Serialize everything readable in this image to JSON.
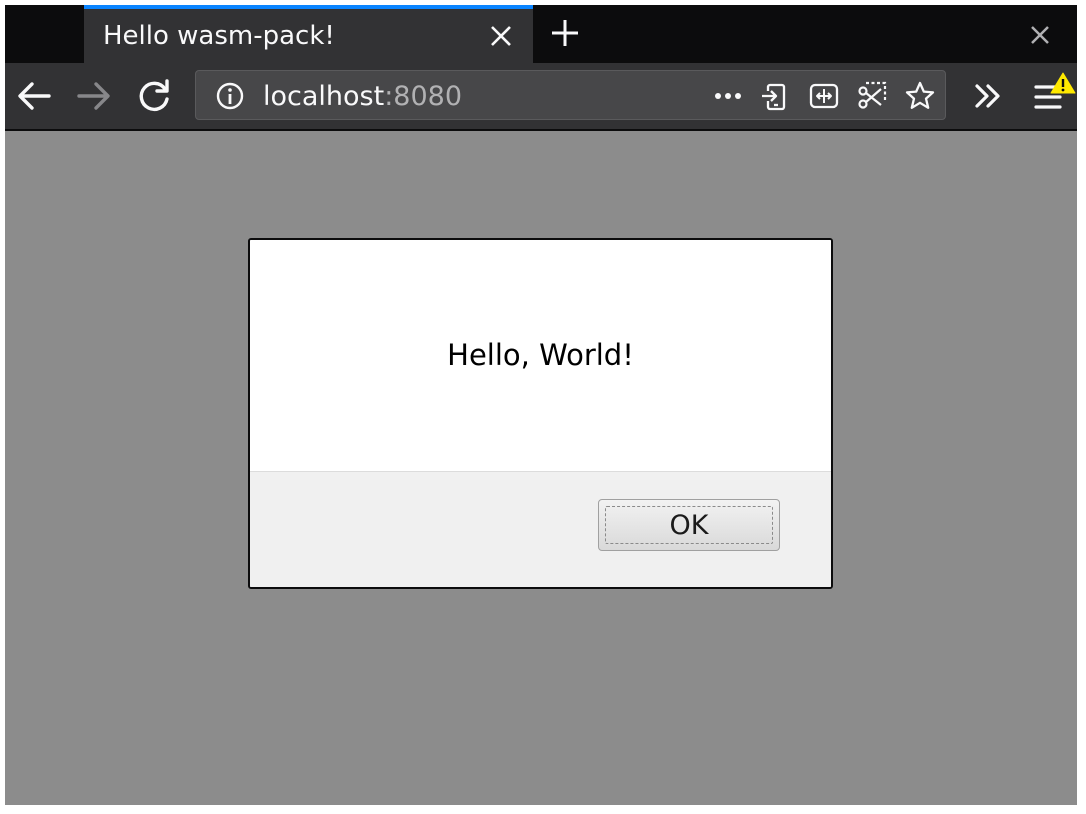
{
  "browser": {
    "tab": {
      "title": "Hello wasm-pack!",
      "close_icon": "close-icon"
    },
    "new_tab_icon": "plus-icon",
    "window_close_icon": "close-icon",
    "nav": {
      "back_icon": "arrow-left-icon",
      "forward_icon": "arrow-right-icon",
      "reload_icon": "reload-icon",
      "overflow_icon": "chevron-double-right-icon",
      "menu_icon": "hamburger-menu-icon",
      "warning_icon": "warning-icon"
    },
    "urlbar": {
      "host": "localhost",
      "port": ":8080",
      "info_icon": "info-icon",
      "page_actions_icon": "more-dots-icon",
      "send_to_device_icon": "send-to-device-icon",
      "reader_view_icon": "reader-view-icon",
      "screenshot_icon": "screenshot-icon",
      "bookmark_icon": "star-icon"
    }
  },
  "dialog": {
    "message": "Hello, World!",
    "ok_label": "OK"
  },
  "colors": {
    "tab_accent": "#0a84ff",
    "toolbar_bg": "#323234",
    "overlay_bg": "#8c8c8c",
    "warning": "#ffe900"
  }
}
